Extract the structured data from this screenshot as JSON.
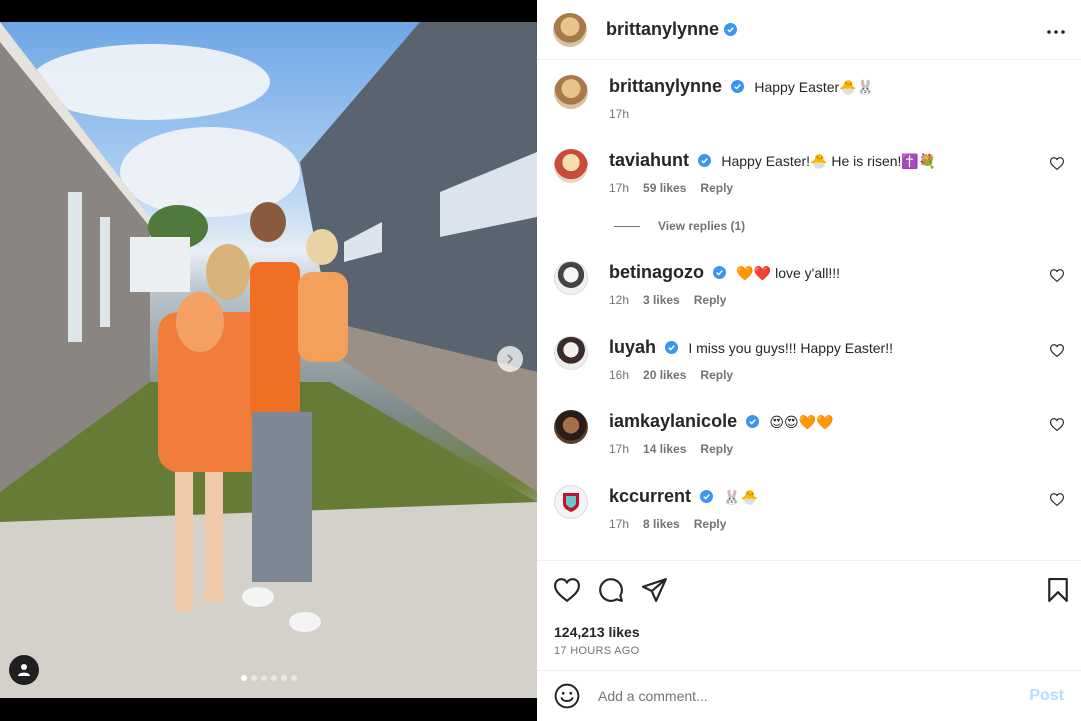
{
  "post": {
    "author": "brittanylynne",
    "caption": "Happy Easter🐣🐰",
    "caption_time": "17h",
    "likes": "124,213 likes",
    "time_ago": "17 HOURS AGO",
    "carousel": {
      "count": 6,
      "active": 0
    }
  },
  "comments": [
    {
      "user": "taviahunt",
      "text": "Happy Easter!🐣 He is risen!✝️💐",
      "time": "17h",
      "likes": "59 likes",
      "reply": "Reply",
      "view_replies": "View replies (1)"
    },
    {
      "user": "betinagozo",
      "text": "🧡❤️ love y'all!!!",
      "time": "12h",
      "likes": "3 likes",
      "reply": "Reply"
    },
    {
      "user": "luyah",
      "text": "I miss you guys!!! Happy Easter!!",
      "time": "16h",
      "likes": "20 likes",
      "reply": "Reply"
    },
    {
      "user": "iamkaylanicole",
      "text": "😍😍🧡🧡",
      "time": "17h",
      "likes": "14 likes",
      "reply": "Reply"
    },
    {
      "user": "kccurrent",
      "text": "🐰🐣",
      "time": "17h",
      "likes": "8 likes",
      "reply": "Reply"
    }
  ],
  "add_comment": {
    "placeholder": "Add a comment...",
    "post_label": "Post"
  },
  "colors": {
    "verified": "#3897f0",
    "post_disabled": "#b2dffc",
    "muted": "#737373"
  },
  "icons": [
    "more-horizontal-icon",
    "heart-icon",
    "comment-icon",
    "share-icon",
    "bookmark-icon",
    "emoji-icon",
    "verified-badge-icon",
    "user-tag-icon",
    "chevron-right-icon"
  ]
}
